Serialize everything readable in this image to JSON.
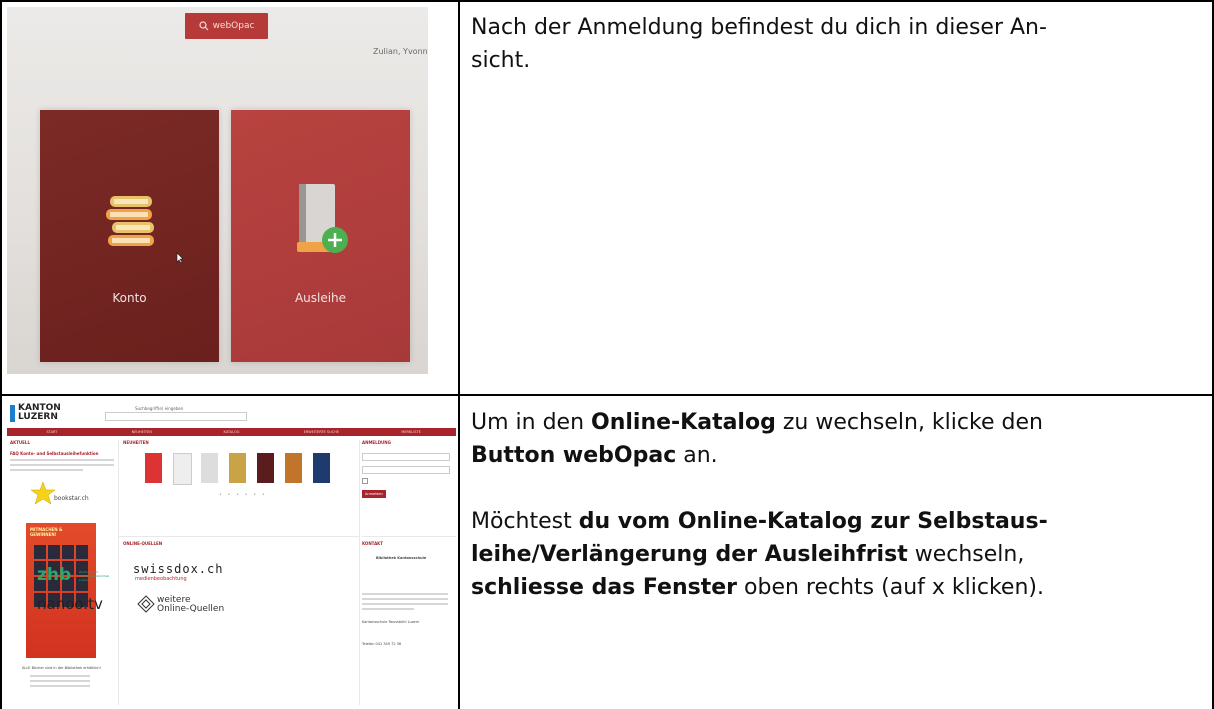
{
  "row1": {
    "photo": {
      "webopac_button": "webOpac",
      "user_name": "Zulian, Yvonn",
      "tile_konto": "Konto",
      "tile_ausleihe": "Ausleihe"
    },
    "text": {
      "line1": "Nach der Anmeldung befindest du dich in dieser An-",
      "line2": "sicht."
    }
  },
  "row2": {
    "screenshot": {
      "logo_line1": "KANTON",
      "logo_line2": "LUZERN",
      "search_label": "Suchbegriff(e) eingeben",
      "nav": [
        "START",
        "NEUHEITEN",
        "KATALOG",
        "ERWEITERTE SUCHE",
        "MERKLISTE"
      ],
      "left_heading": "AKTUELL",
      "faq_title": "FAQ Konto- und Selbstausleihefunktion",
      "bookstar": "bookstar.ch",
      "promo_title": "MITMACHEN & GEWINNEN!",
      "footer_note": "ALLE Bücher sind in der Bibliothek erhältlich!",
      "center_heading": "NEUHEITEN",
      "online_heading": "ONLINE-QUELLEN",
      "zhb": "zhb",
      "zhb_sub": "Zentral- und Hochschulbibliothek Luzern",
      "swissdox": "swissdox.ch",
      "swissdox_sub": "medienbeobachtung",
      "nanoo": "nanoo.tv",
      "weitere_line1": "weitere",
      "weitere_line2": "Online-Quellen",
      "right_heading": "ANMELDUNG",
      "login_button": "Anmelden",
      "kontakt_heading": "KONTAKT",
      "kontakt_name": "Bibliothek Kantonsschule",
      "address": "Kantonsschule Reussbühl Luzern",
      "phone": "Telefon 041 349 72 36"
    },
    "text": {
      "p1_a": "Um in den ",
      "p1_b": "Online-Katalog",
      "p1_c": " zu wechseln, klicke den",
      "p1_d": "Button webOpac",
      "p1_e": " an.",
      "p2_a": "Möchtest ",
      "p2_b": "du vom Online-Katalog zur Selbstaus-",
      "p2_c": "leihe/Verlängerung der Ausleihfrist",
      "p2_d": " wechseln,",
      "p2_e": "schliesse das Fenster",
      "p2_f": " oben rechts (auf x klicken)."
    }
  },
  "colors": {
    "dark_red": "#7c2a26",
    "red": "#b8433f",
    "nav_red": "#a7242b",
    "zhb_green": "#2aa86c"
  }
}
